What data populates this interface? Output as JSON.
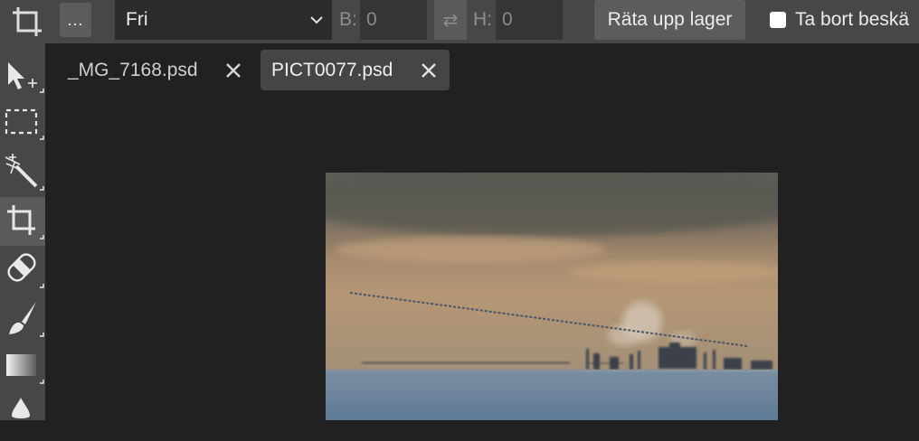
{
  "options_bar": {
    "more_label": "...",
    "ratio_value": "Fri",
    "width_label": "B:",
    "width_value": "0",
    "swap_symbol": "⇄",
    "height_label": "H:",
    "height_value": "0",
    "straighten_label": "Räta upp lager",
    "delete_cropped_label": "Ta bort beskä",
    "delete_cropped_checked": false
  },
  "tools": [
    {
      "name": "move-tool",
      "active": false
    },
    {
      "name": "marquee-tool",
      "active": false
    },
    {
      "name": "magic-wand-tool",
      "active": false
    },
    {
      "name": "crop-tool",
      "active": true
    },
    {
      "name": "healing-tool",
      "active": false
    },
    {
      "name": "brush-tool",
      "active": false
    },
    {
      "name": "gradient-tool",
      "active": false
    },
    {
      "name": "blur-tool",
      "active": false
    }
  ],
  "tabs": [
    {
      "label": "_MG_7168.psd",
      "active": false
    },
    {
      "label": "PICT0077.psd",
      "active": true
    }
  ],
  "colors": {
    "background": "#212121",
    "panel": "#474747",
    "active_tab": "#454545"
  }
}
